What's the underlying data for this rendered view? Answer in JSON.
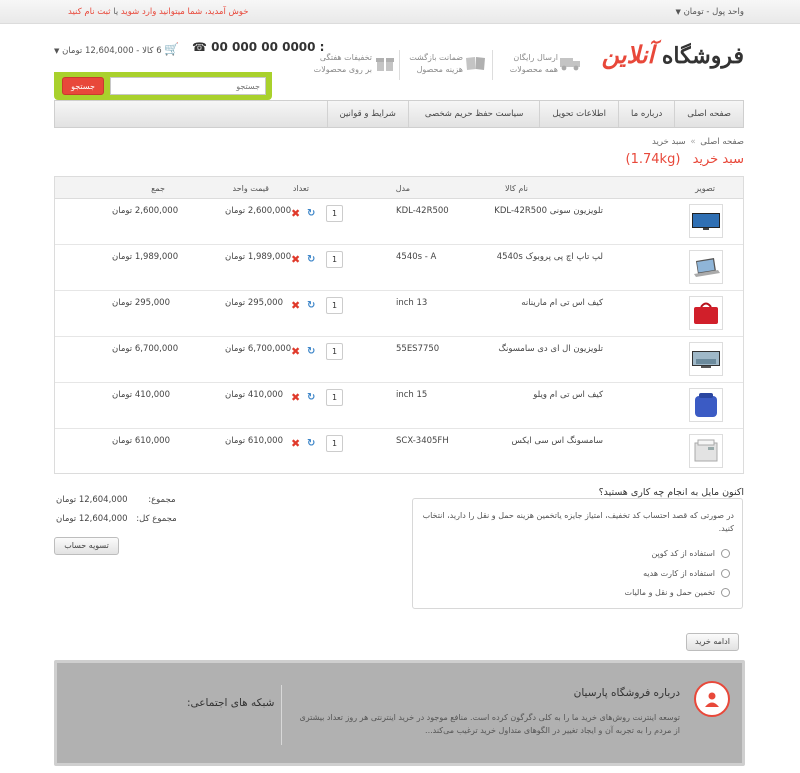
{
  "topbar": {
    "currency_label": "واحد پول - تومان",
    "currency_chevron": "chevron-down-icon",
    "welcome_prefix": "خوش آمدید، شما میتوانید",
    "login_link": "وارد شوید",
    "or": "یا",
    "register_link": "ثبت نام کنید"
  },
  "header": {
    "logo_text_main": "فروشگاه",
    "logo_text_accent": "آنلاین",
    "features": [
      {
        "line1": "ارسال رایگان",
        "line2": "همه محصولات",
        "icon": "truck-icon"
      },
      {
        "line1": "ضمانت بازگشت",
        "line2": "هزینه محصول",
        "icon": "book-icon"
      },
      {
        "line1": "تخفیفات هفتگی",
        "line2": "بر روی محصولات",
        "icon": "gift-icon"
      }
    ],
    "phone": "☎ 00 000 00 0000 :",
    "cart_summary": "6 کالا - 12,604,000 تومان"
  },
  "search": {
    "placeholder": "جستجو",
    "button_label": "جستجو"
  },
  "nav": {
    "items": [
      "صفحه اصلی",
      "درباره ما",
      "اطلاعات تحویل",
      "سیاست حفظ حریم شخصی",
      "شرایط و قوانین"
    ]
  },
  "breadcrumb": {
    "home": "صفحه اصلی",
    "separator": "»",
    "current": "سبد خرید"
  },
  "page": {
    "title": "سبد خرید",
    "weight": "(1.74kg)"
  },
  "table": {
    "headers": {
      "image": "تصویر",
      "name": "نام کالا",
      "model": "مدل",
      "quantity": "تعداد",
      "unit_price": "قیمت واحد",
      "total": "جمع"
    },
    "rows": [
      {
        "name": "تلویزیون سونی KDL-42R500",
        "model": "KDL-42R500",
        "qty": "1",
        "unit_price": "2,600,000 تومان",
        "total": "2,600,000 تومان",
        "thumb": "tv-icon"
      },
      {
        "name": "لپ تاپ اچ پی پروبوک 4540s",
        "model": "4540s - A",
        "qty": "1",
        "unit_price": "1,989,000 تومان",
        "total": "1,989,000 تومان",
        "thumb": "laptop-icon"
      },
      {
        "name": "کیف اس تی ام مارینانه",
        "model": "inch 13",
        "qty": "1",
        "unit_price": "295,000 تومان",
        "total": "295,000 تومان",
        "thumb": "red-bag-icon"
      },
      {
        "name": "تلویزیون ال ای دی سامسونگ",
        "model": "55ES7750",
        "qty": "1",
        "unit_price": "6,700,000 تومان",
        "total": "6,700,000 تومان",
        "thumb": "tv-icon"
      },
      {
        "name": "کیف اس تی ام ویلو",
        "model": "inch 15",
        "qty": "1",
        "unit_price": "410,000 تومان",
        "total": "410,000 تومان",
        "thumb": "blue-bag-icon"
      },
      {
        "name": "سامسونگ اس سی ایکس",
        "model": "SCX-3405FH",
        "qty": "1",
        "unit_price": "610,000 تومان",
        "total": "610,000 تومان",
        "thumb": "printer-icon"
      }
    ]
  },
  "next_step": {
    "question": "اکنون مایل به انجام چه کاری هستید؟",
    "description": "در صورتی که قصد احتساب کد تخفیف، امتیاز جایزه یاتخمین هزینه حمل و نقل را دارید، انتخاب کنید.",
    "options": [
      "استفاده از کد کوپن",
      "استفاده از کارت هدیه",
      "تخمین حمل و نقل و مالیات"
    ]
  },
  "totals": {
    "subtotal_label": "مجموع:",
    "subtotal_value": "12,604,000 تومان",
    "grand_label": "مجموع کل:",
    "grand_value": "12,604,000 تومان",
    "checkout_button": "تسویه حساب",
    "continue_button": "ادامه خرید"
  },
  "footer": {
    "about_title": "درباره فروشگاه پارسیان",
    "about_text": "توسعه اینترنت روش‌های خرید ما را به کلی دگرگون کرده است. منافع موجود در خرید اینترنتی هر روز تعداد بیشتری از مردم را به تجربه آن و ایجاد تغییر در الگوهای متداول خرید ترغیب می‌کند...",
    "social_title": "شبکه های اجتماعی:"
  },
  "colors": {
    "accent": "#e8483a",
    "search_frame": "#a9d12c",
    "refresh": "#3e86c9"
  }
}
